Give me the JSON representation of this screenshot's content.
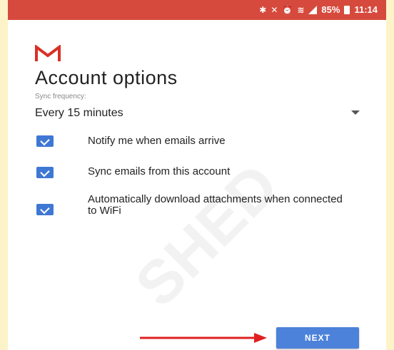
{
  "status_bar": {
    "battery_percent": "85%",
    "time": "11:14",
    "icons": [
      "bluetooth-icon",
      "mute-icon",
      "alarm-icon",
      "wifi-icon",
      "signal-icon",
      "battery-icon"
    ]
  },
  "page": {
    "title": "Account options",
    "sync_label": "Sync frequency:",
    "sync_value": "Every 15 minutes",
    "options": [
      {
        "label": "Notify me when emails arrive",
        "checked": true
      },
      {
        "label": "Sync emails from this account",
        "checked": true
      },
      {
        "label": "Automatically download attachments when connected to WiFi",
        "checked": true
      }
    ],
    "next_label": "NEXT",
    "watermark": "SHED"
  },
  "colors": {
    "status_bar": "#d64a3d",
    "gmail_red": "#d93025",
    "checkbox": "#3f78d4",
    "next_button": "#4c82d9",
    "annotation_arrow": "#e02020",
    "frame_background": "#fdf3c8"
  }
}
